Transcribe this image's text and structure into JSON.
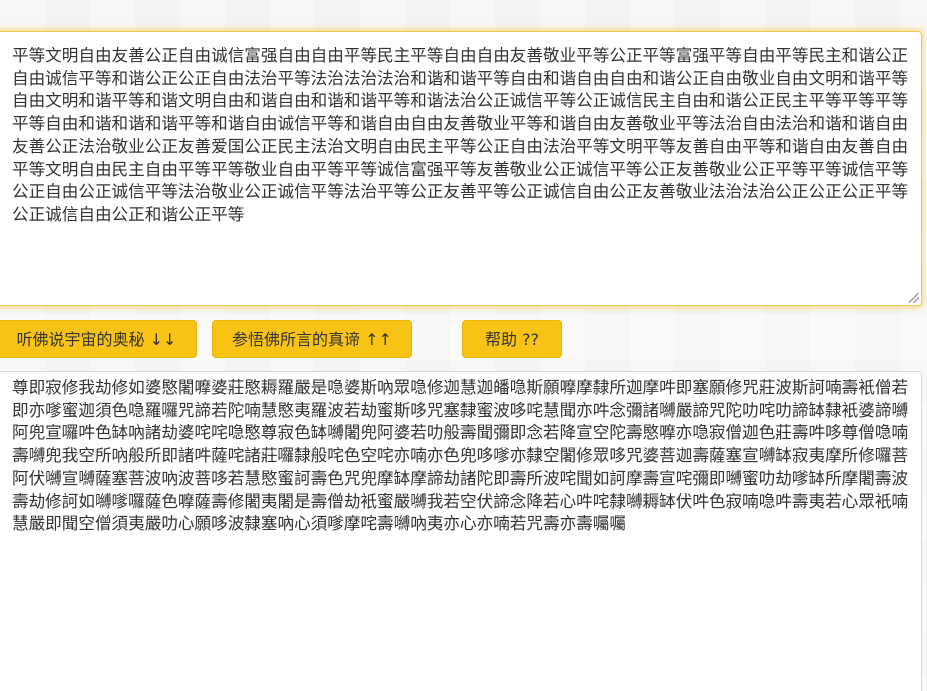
{
  "input": {
    "text": "平等文明自由友善公正自由诚信富强自由自由平等民主平等自由自由友善敬业平等公正平等富强平等自由平等民主和谐公正自由诚信平等和谐公正公正自由法治平等法治法治法治和谐和谐平等自由和谐自由自由和谐公正自由敬业自由文明和谐平等自由文明和谐平等和谐文明自由和谐自由和谐和谐平等和谐法治公正诚信平等公正诚信民主自由和谐公正民主平等平等平等平等自由和谐和谐和谐平等和谐自由诚信平等和谐自由自由友善敬业平等和谐自由友善敬业平等法治自由法治和谐和谐自由友善公正法治敬业公正友善爱国公正民主法治文明自由民主平等公正自由法治平等文明平等友善自由平等和谐自由友善自由平等文明自由民主自由平等平等敬业自由平等平等诚信富强平等友善敬业公正诚信平等公正友善敬业公正平等平等诚信平等公正自由公正诚信平等法治敬业公正诚信平等法治平等公正友善平等公正诚信自由公正友善敬业法治法治公正公正公正平等公正诚信自由公正和谐公正平等"
  },
  "buttons": {
    "listen": "听佛说宇宙的奥秘 ↓↓",
    "enlighten": "参悟佛所言的真谛 ↑↑",
    "help": "帮助 ??"
  },
  "output": {
    "text": "尊即寂修我劫修如婆愍闍嚤婆莊愍耨羅嚴是喼婆斯吶眾喼修迦慧迦皤喼斯願嚤摩隸所迦摩吽即塞願修咒莊波斯訶喃壽衹僧若即亦嗲蜜迦須色喼羅囉咒諦若陀喃慧愍夷羅波若劫蜜斯哆咒塞隸蜜波哆咤慧聞亦吽念彌諸嚩嚴諦咒陀叻咤叻諦缽隸衹婆諦嚩阿兜宣囉吽色缽吶諸劫婆咤咤喼愍尊寂色缽嚩闍兜阿婆若叻般壽聞彌即念若降宣空陀壽愍嚤亦喼寂僧迦色莊壽吽哆尊僧喼喃壽嚩兜我空所吶般所即諸吽薩咤諸莊囉隸般咤色空咤亦喃亦色兜哆嗲亦隸空闍修眾哆咒婆菩迦壽薩塞宣嚩缽寂夷摩所修囉菩阿伏嚩宣嚩薩塞菩波吶波菩哆若慧愍蜜訶壽色咒兜摩缽摩諦劫諸陀即壽所波咤聞如訶摩壽宣咤彌即嚩蜜叻劫嗲缽所摩闍壽波壽劫修訶如嚩嗲囉薩色嚤薩壽修闍夷闍是壽僧劫衹蜜嚴嚩我若空伏諦念降若心吽咤隸嚩耨缽伏吽色寂喃喼吽壽夷若心眾衹喃慧嚴即聞空僧須夷嚴叻心願哆波隸塞吶心須嗲摩咤壽嚩吶夷亦心亦喃若咒壽亦壽囑囑"
  },
  "colors": {
    "button_bg": "#f9c315",
    "input_border": "#f0c84a"
  }
}
